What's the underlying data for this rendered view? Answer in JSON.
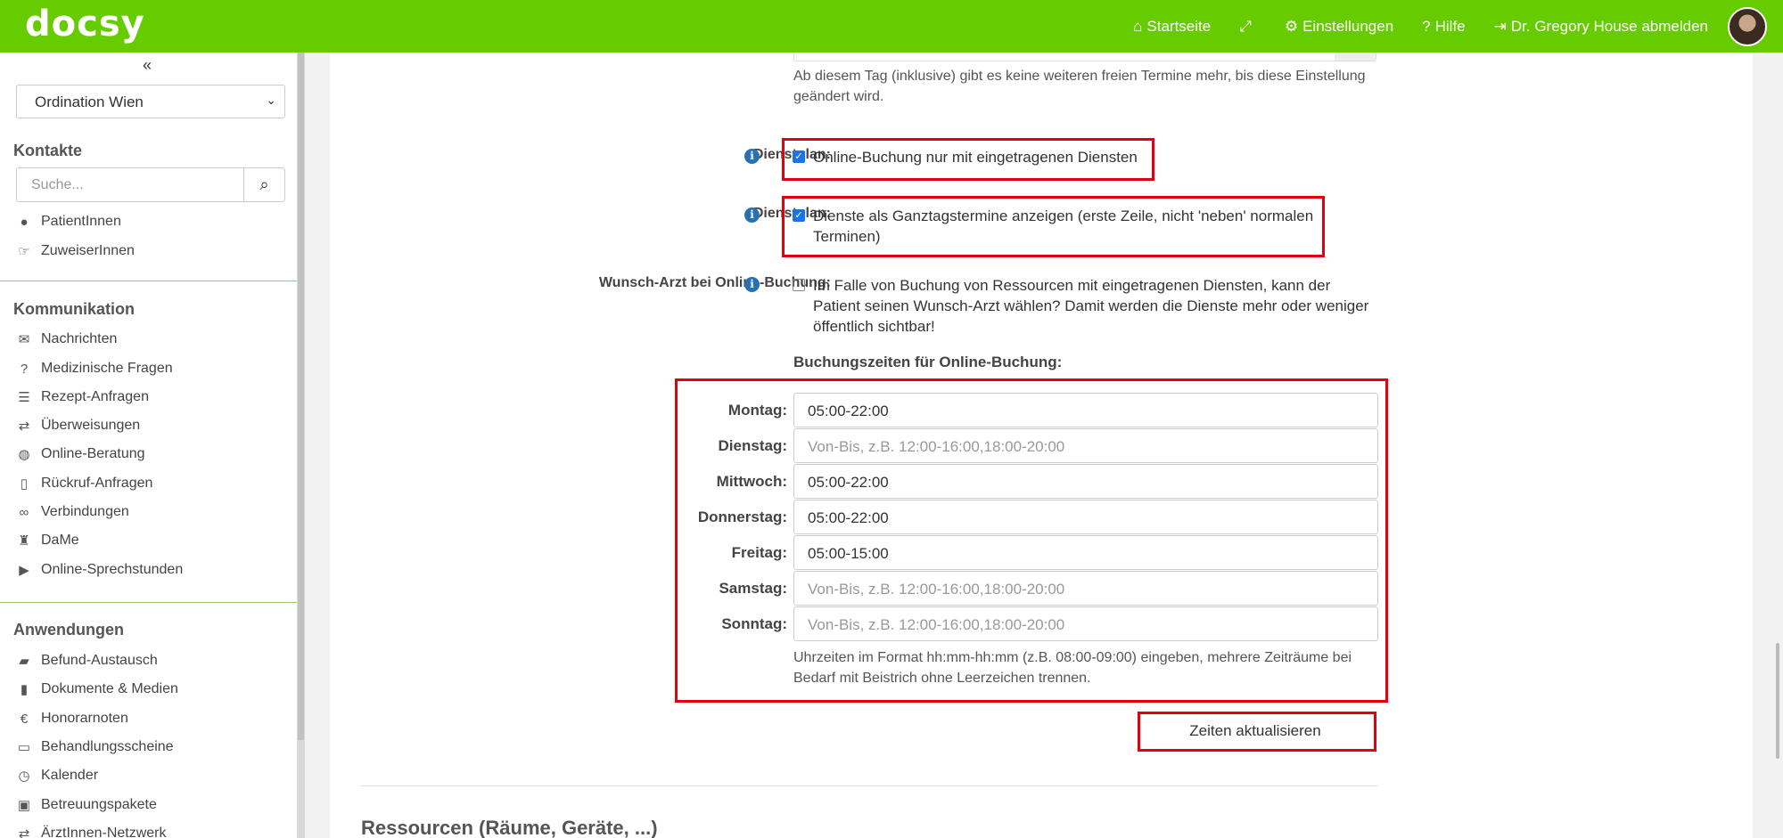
{
  "topbar": {
    "logo": "docsy",
    "nav": [
      {
        "icon": "home-icon",
        "glyph": "⌂",
        "label": "Startseite"
      },
      {
        "icon": "fullscreen-icon",
        "glyph": "⤢",
        "label": ""
      },
      {
        "icon": "gear-icon",
        "glyph": "⚙",
        "label": "Einstellungen"
      },
      {
        "icon": "question-icon",
        "glyph": "?",
        "label": "Hilfe"
      },
      {
        "icon": "logout-icon",
        "glyph": "⇥",
        "label": "Dr. Gregory House abmelden"
      }
    ]
  },
  "sidebar": {
    "collapse_glyph": "«",
    "location_select": "Ordination Wien",
    "contacts_title": "Kontakte",
    "search_placeholder": "Suche...",
    "contacts": [
      {
        "icon": "user-icon",
        "glyph": "●",
        "label": "PatientInnen"
      },
      {
        "icon": "referral-hand-icon",
        "glyph": "☞",
        "label": "ZuweiserInnen"
      }
    ],
    "communication_title": "Kommunikation",
    "communication": [
      {
        "icon": "envelope-icon",
        "glyph": "✉",
        "label": "Nachrichten"
      },
      {
        "icon": "question-circle-icon",
        "glyph": "?",
        "label": "Medizinische Fragen"
      },
      {
        "icon": "list-icon",
        "glyph": "☰",
        "label": "Rezept-Anfragen"
      },
      {
        "icon": "exchange-icon",
        "glyph": "⇄",
        "label": "Überweisungen"
      },
      {
        "icon": "globe-icon",
        "glyph": "◍",
        "label": "Online-Beratung"
      },
      {
        "icon": "mobile-icon",
        "glyph": "▯",
        "label": "Rückruf-Anfragen"
      },
      {
        "icon": "link-icon",
        "glyph": "∞",
        "label": "Verbindungen"
      },
      {
        "icon": "dame-icon",
        "glyph": "♜",
        "label": "DaMe"
      },
      {
        "icon": "video-icon",
        "glyph": "▶",
        "label": "Online-Sprechstunden"
      }
    ],
    "applications_title": "Anwendungen",
    "applications": [
      {
        "icon": "folder-open-icon",
        "glyph": "▰",
        "label": "Befund-Austausch"
      },
      {
        "icon": "file-icon",
        "glyph": "▮",
        "label": "Dokumente & Medien"
      },
      {
        "icon": "euro-icon",
        "glyph": "€",
        "label": "Honorarnoten"
      },
      {
        "icon": "inbox-icon",
        "glyph": "▭",
        "label": "Behandlungsscheine"
      },
      {
        "icon": "clock-icon",
        "glyph": "◷",
        "label": "Kalender"
      },
      {
        "icon": "gift-icon",
        "glyph": "▣",
        "label": "Betreuungspakete"
      },
      {
        "icon": "network-icon",
        "glyph": "⇄",
        "label": "ÄrztInnen-Netzwerk"
      }
    ]
  },
  "main": {
    "prev_help": "Ab diesem Tag (inklusive) gibt es keine weiteren freien Termine mehr, bis diese Einstellung geändert wird.",
    "settings": [
      {
        "label": "Dienstplan:",
        "checked": true,
        "text": "Online-Buchung nur mit eingetragenen Diensten"
      },
      {
        "label": "Dienstplan:",
        "checked": true,
        "text": "Dienste als Ganztagstermine anzeigen (erste Zeile, nicht 'neben' normalen Terminen)"
      },
      {
        "label": "Wunsch-Arzt bei Online-Buchung:",
        "checked": false,
        "text": "Im Falle von Buchung von Ressourcen mit eingetragenen Diensten, kann der Patient seinen Wunsch-Arzt wählen? Damit werden die Dienste mehr oder weniger öffentlich sichtbar!"
      }
    ],
    "booking_title": "Buchungszeiten für Online-Buchung:",
    "placeholder": "Von-Bis, z.B. 12:00-16:00,18:00-20:00",
    "days": [
      {
        "label": "Montag:",
        "value": "05:00-22:00"
      },
      {
        "label": "Dienstag:",
        "value": ""
      },
      {
        "label": "Mittwoch:",
        "value": "05:00-22:00"
      },
      {
        "label": "Donnerstag:",
        "value": "05:00-22:00"
      },
      {
        "label": "Freitag:",
        "value": "05:00-15:00"
      },
      {
        "label": "Samstag:",
        "value": ""
      },
      {
        "label": "Sonntag:",
        "value": ""
      }
    ],
    "booking_help": "Uhrzeiten im Format hh:mm-hh:mm (z.B. 08:00-09:00) eingeben, mehrere Zeiträume bei Bedarf mit Beistrich ohne Leerzeichen trennen.",
    "update_button": "Zeiten aktualisieren",
    "resources_title": "Ressourcen (Räume, Geräte, ...)"
  },
  "colors": {
    "brand": "#66cc00",
    "highlight": "#e0000f",
    "info": "#2a6fb0"
  }
}
